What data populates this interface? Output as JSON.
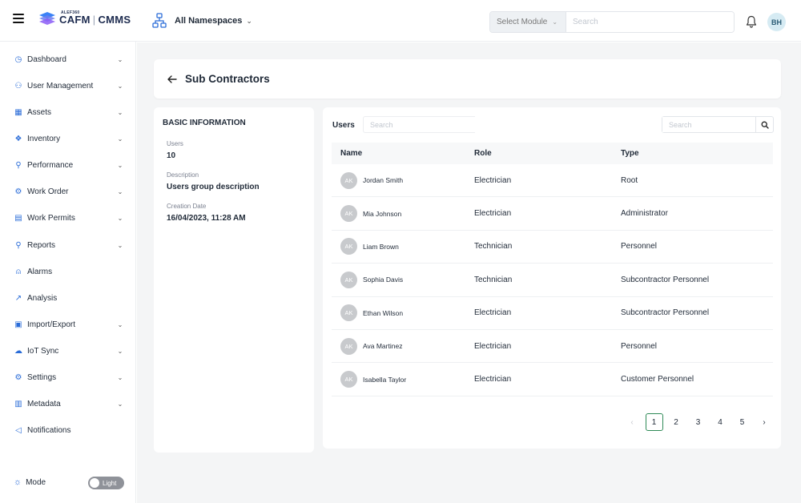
{
  "app": {
    "brand_small": "ALEF360",
    "brand_left": "CAFM",
    "brand_right": "CMMS",
    "namespace": "All Namespaces",
    "module_select": "Select Module",
    "search_placeholder": "Search",
    "user_initials": "BH"
  },
  "sidebar": {
    "items": [
      {
        "label": "Dashboard",
        "icon": "gauge-icon",
        "glyph": "◷",
        "chevron": true
      },
      {
        "label": "User Management",
        "icon": "user-icon",
        "glyph": "⚇",
        "chevron": true
      },
      {
        "label": "Assets",
        "icon": "grid-icon",
        "glyph": "▦",
        "chevron": true
      },
      {
        "label": "Inventory",
        "icon": "boxes-icon",
        "glyph": "❖",
        "chevron": true
      },
      {
        "label": "Performance",
        "icon": "network-icon",
        "glyph": "⚲",
        "chevron": true
      },
      {
        "label": "Work Order",
        "icon": "cog-nodes-icon",
        "glyph": "⚙",
        "chevron": true
      },
      {
        "label": "Work Permits",
        "icon": "document-icon",
        "glyph": "▤",
        "chevron": true
      },
      {
        "label": "Reports",
        "icon": "hierarchy-icon",
        "glyph": "⚲",
        "chevron": true
      },
      {
        "label": "Alarms",
        "icon": "siren-icon",
        "glyph": "⍝",
        "chevron": false
      },
      {
        "label": "Analysis",
        "icon": "line-chart-icon",
        "glyph": "↗",
        "chevron": false
      },
      {
        "label": "Import/Export",
        "icon": "import-export-icon",
        "glyph": "▣",
        "chevron": true
      },
      {
        "label": "IoT Sync",
        "icon": "cloud-sync-icon",
        "glyph": "☁",
        "chevron": true
      },
      {
        "label": "Settings",
        "icon": "settings-icon",
        "glyph": "⚙",
        "chevron": true
      },
      {
        "label": "Metadata",
        "icon": "bar-chart-icon",
        "glyph": "▥",
        "chevron": true
      },
      {
        "label": "Notifications",
        "icon": "megaphone-icon",
        "glyph": "◁",
        "chevron": false
      }
    ],
    "mode_label": "Mode",
    "mode_value": "Light"
  },
  "page": {
    "title": "Sub Contractors"
  },
  "info": {
    "heading": "BASIC INFORMATION",
    "fields": [
      {
        "key": "Users",
        "value": "10"
      },
      {
        "key": "Description",
        "value": "Users group description"
      },
      {
        "key": "Creation Date",
        "value": "16/04/2023, 11:28 AM"
      }
    ]
  },
  "users": {
    "label": "Users",
    "search_placeholder": "Search",
    "right_search_placeholder": "Search",
    "columns": [
      "Name",
      "Role",
      "Type"
    ],
    "rows": [
      {
        "initials": "AK",
        "name": "Jordan Smith",
        "role": "Electrician",
        "type": "Root"
      },
      {
        "initials": "AK",
        "name": "Mia Johnson",
        "role": "Electrician",
        "type": "Administrator"
      },
      {
        "initials": "AK",
        "name": "Liam Brown",
        "role": "Technician",
        "type": "Personnel"
      },
      {
        "initials": "AK",
        "name": "Sophia Davis",
        "role": "Technician",
        "type": "Subcontractor Personnel"
      },
      {
        "initials": "AK",
        "name": "Ethan Wilson",
        "role": "Electrician",
        "type": "Subcontractor Personnel"
      },
      {
        "initials": "AK",
        "name": "Ava Martinez",
        "role": "Electrician",
        "type": "Personnel"
      },
      {
        "initials": "AK",
        "name": "Isabella Taylor",
        "role": "Electrician",
        "type": "Customer Personnel"
      }
    ],
    "pagination": {
      "pages": [
        "1",
        "2",
        "3",
        "4",
        "5"
      ],
      "current": "1",
      "prev": "‹",
      "next": "›"
    }
  },
  "colors": {
    "accent": "#2a6cd8",
    "active_page": "#2f8a57",
    "background": "#f4f5f6"
  }
}
